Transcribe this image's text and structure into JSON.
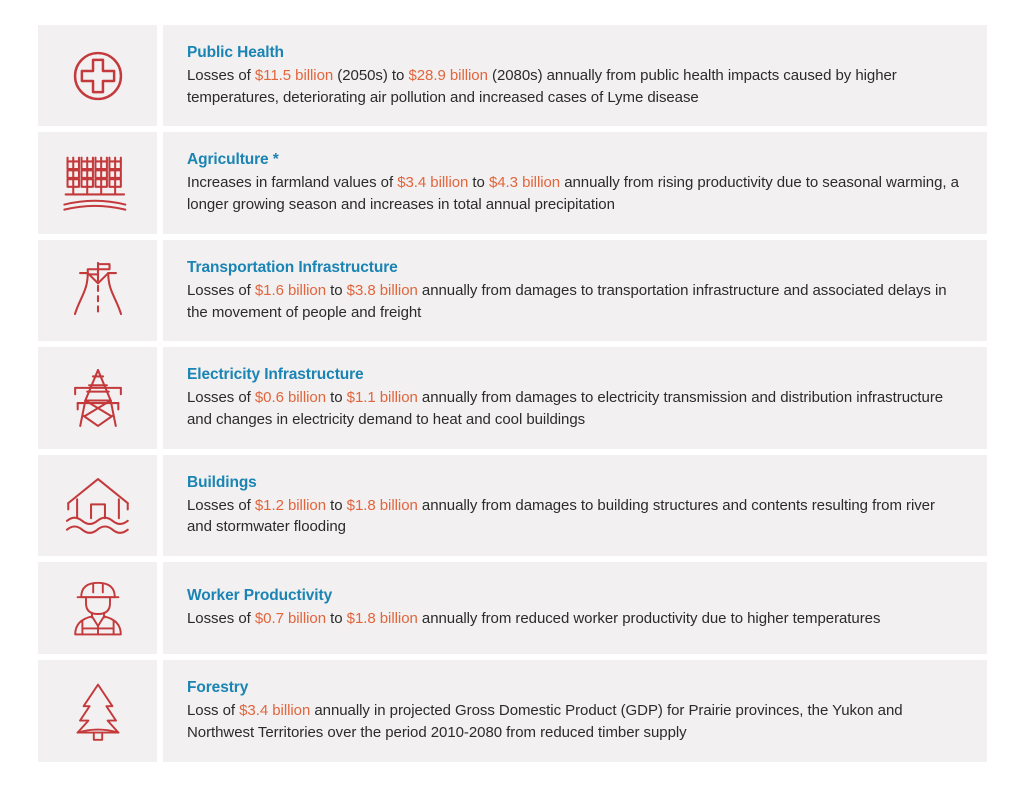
{
  "page": {
    "background_color": "#ffffff",
    "panel_color": "#f2f0f0",
    "title_color": "#1a84b4",
    "amount_color": "#e2653c",
    "icon_color": "#c4393b",
    "body_text_color": "#2b2b2b"
  },
  "rows": [
    {
      "icon": "medical-cross-circle-icon",
      "title": "Public Health",
      "segments": [
        {
          "text": "Losses of ",
          "style": "normal"
        },
        {
          "text": "$11.5 billion",
          "style": "amount"
        },
        {
          "text": " (2050s) to ",
          "style": "normal"
        },
        {
          "text": "$28.9 billion",
          "style": "amount"
        },
        {
          "text": " (2080s) annually from public health impacts caused by higher temperatures, deteriorating air pollution and increased cases of Lyme disease",
          "style": "normal"
        }
      ],
      "plain_text": "Losses of $11.5 billion (2050s) to $28.9 billion (2080s) annually from public health impacts caused by higher temperatures, deteriorating air pollution and increased cases of Lyme disease"
    },
    {
      "icon": "wheat-stalks-icon",
      "title": "Agriculture *",
      "segments": [
        {
          "text": "Increases in farmland values of ",
          "style": "normal"
        },
        {
          "text": "$3.4 billion",
          "style": "amount"
        },
        {
          "text": " to ",
          "style": "normal"
        },
        {
          "text": "$4.3 billion",
          "style": "amount"
        },
        {
          "text": " annually from rising productivity due to seasonal warming, a longer growing season and increases in total annual precipitation",
          "style": "normal"
        }
      ],
      "plain_text": "Increases in farmland values of $3.4 billion to $4.3 billion annually from rising productivity due to seasonal warming, a longer growing season and increases in total annual precipitation"
    },
    {
      "icon": "highway-road-sign-icon",
      "title": "Transportation Infrastructure",
      "segments": [
        {
          "text": "Losses of ",
          "style": "normal"
        },
        {
          "text": "$1.6 billion",
          "style": "amount"
        },
        {
          "text": " to ",
          "style": "normal"
        },
        {
          "text": "$3.8 billion",
          "style": "amount"
        },
        {
          "text": " annually from damages to transportation infrastructure and associated delays in the movement of people and freight",
          "style": "normal"
        }
      ],
      "plain_text": "Losses of $1.6 billion to $3.8 billion annually from damages to transportation infrastructure and associated delays in the movement of people and freight"
    },
    {
      "icon": "transmission-tower-icon",
      "title": "Electricity Infrastructure",
      "segments": [
        {
          "text": "Losses of ",
          "style": "normal"
        },
        {
          "text": "$0.6 billion",
          "style": "amount"
        },
        {
          "text": " to ",
          "style": "normal"
        },
        {
          "text": "$1.1 billion",
          "style": "amount"
        },
        {
          "text": " annually from damages to electricity transmission and distribution infrastructure and changes in electricity demand to heat and cool buildings",
          "style": "normal"
        }
      ],
      "plain_text": "Losses of $0.6 billion to $1.1 billion annually from damages to electricity transmission and distribution infrastructure and changes in electricity demand to heat and cool buildings"
    },
    {
      "icon": "flooded-house-icon",
      "title": "Buildings",
      "segments": [
        {
          "text": "Losses of ",
          "style": "normal"
        },
        {
          "text": "$1.2 billion",
          "style": "amount"
        },
        {
          "text": " to ",
          "style": "normal"
        },
        {
          "text": "$1.8 billion",
          "style": "amount"
        },
        {
          "text": " annually from damages to building structures and contents resulting from river and stormwater flooding",
          "style": "normal"
        }
      ],
      "plain_text": "Losses of $1.2 billion to $1.8 billion annually from damages to building structures and contents resulting from river and stormwater flooding"
    },
    {
      "icon": "construction-worker-icon",
      "title": "Worker Productivity",
      "segments": [
        {
          "text": "Losses of ",
          "style": "normal"
        },
        {
          "text": "$0.7 billion",
          "style": "amount"
        },
        {
          "text": " to ",
          "style": "normal"
        },
        {
          "text": "$1.8 billion",
          "style": "amount"
        },
        {
          "text": " annually from reduced worker productivity due to higher temperatures",
          "style": "normal"
        }
      ],
      "plain_text": "Losses of $0.7 billion to $1.8 billion annually from reduced worker productivity due to higher temperatures"
    },
    {
      "icon": "pine-tree-icon",
      "title": "Forestry",
      "segments": [
        {
          "text": "Loss of ",
          "style": "normal"
        },
        {
          "text": "$3.4 billion",
          "style": "amount"
        },
        {
          "text": " annually in projected Gross Domestic Product (GDP) for Prairie provinces, the Yukon and Northwest Territories over the period 2010-2080 from reduced timber supply",
          "style": "normal"
        }
      ],
      "plain_text": "Loss of $3.4 billion annually in projected Gross Domestic Product (GDP) for Prairie provinces, the Yukon and Northwest Territories over the period 2010-2080 from reduced timber supply"
    }
  ]
}
